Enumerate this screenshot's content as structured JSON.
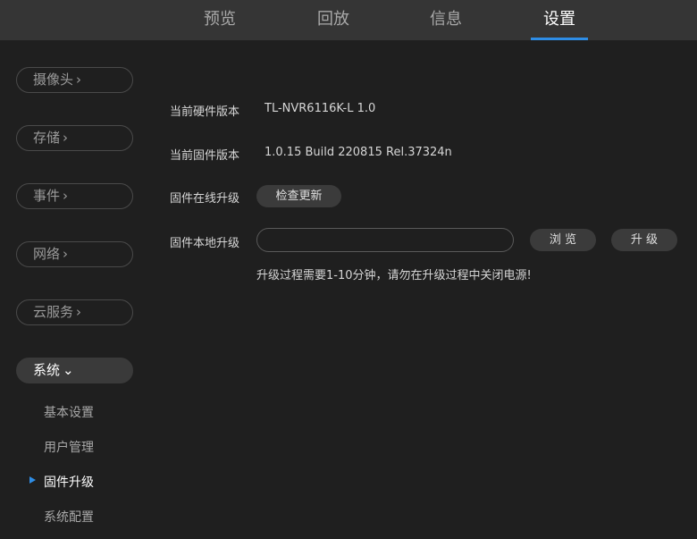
{
  "nav": {
    "tabs": [
      {
        "label": "预览"
      },
      {
        "label": "回放"
      },
      {
        "label": "信息"
      },
      {
        "label": "设置",
        "active": true
      }
    ],
    "accent": "#2e8de6"
  },
  "sidebar": {
    "categories": [
      {
        "label": "摄像头",
        "chevron": "›"
      },
      {
        "label": "存储",
        "chevron": "›"
      },
      {
        "label": "事件",
        "chevron": "›"
      },
      {
        "label": "网络",
        "chevron": "›"
      },
      {
        "label": "云服务",
        "chevron": "›"
      },
      {
        "label": "系统",
        "chevron": "⌄",
        "expanded": true
      }
    ],
    "subitems": [
      {
        "label": "基本设置"
      },
      {
        "label": "用户管理"
      },
      {
        "label": "固件升级",
        "active": true
      },
      {
        "label": "系统配置"
      }
    ]
  },
  "main": {
    "hardware_label": "当前硬件版本",
    "hardware_value": "TL-NVR6116K-L 1.0",
    "firmware_label": "当前固件版本",
    "firmware_value": "1.0.15 Build 220815 Rel.37324n",
    "online_label": "固件在线升级",
    "check_update_button": "检查更新",
    "local_label": "固件本地升级",
    "file_value": "",
    "browse_button": "浏 览",
    "upgrade_button": "升 级",
    "warning": "升级过程需要1-10分钟，请勿在升级过程中关闭电源!"
  }
}
